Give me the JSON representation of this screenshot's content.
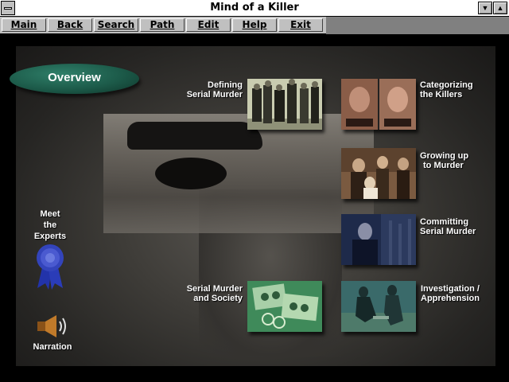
{
  "window": {
    "title": "Mind of a Killer",
    "minimize_glyph": "▼",
    "maximize_glyph": "▲"
  },
  "menu": [
    {
      "label": "Main"
    },
    {
      "label": "Back"
    },
    {
      "label": "Search"
    },
    {
      "label": "Path"
    },
    {
      "label": "Edit"
    },
    {
      "label": "Help"
    },
    {
      "label": "Exit"
    }
  ],
  "overview": {
    "label": "Overview"
  },
  "topics": {
    "defining": {
      "line1": "Defining",
      "line2": "Serial Murder"
    },
    "categorizing": {
      "line1": "Categorizing",
      "line2": "the Killers"
    },
    "growing": {
      "line1": "Growing up",
      "line2": "to Murder"
    },
    "committing": {
      "line1": "Committing",
      "line2": "Serial Murder"
    },
    "society": {
      "line1": "Serial Murder",
      "line2": "and Society"
    },
    "investigation": {
      "line1": "Investigation /",
      "line2": "Apprehension"
    }
  },
  "experts": {
    "line1": "Meet",
    "line2": "the",
    "line3": "Experts",
    "icon": "ribbon-icon"
  },
  "narration": {
    "label": "Narration",
    "icon": "speaker-icon"
  },
  "colors": {
    "overview_pill": "#1c5a49",
    "ribbon": "#3344bb",
    "menu_bg": "#c0c0c0"
  }
}
